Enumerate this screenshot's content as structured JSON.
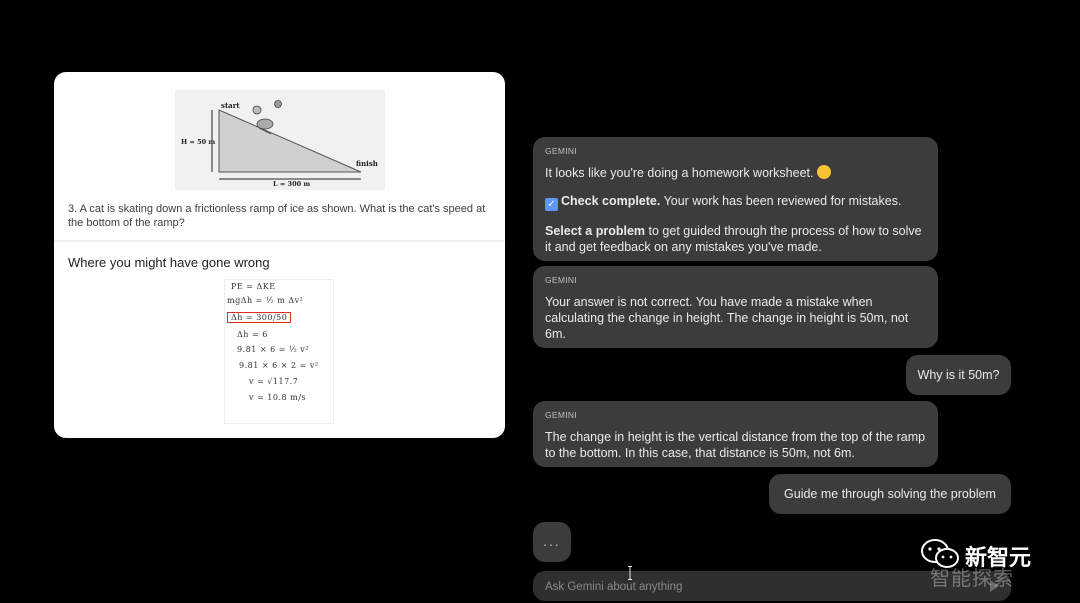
{
  "worksheet": {
    "diagram": {
      "start_label": "start",
      "finish_label": "finish",
      "height_label": "H = 50 m",
      "length_label": "L = 300 m"
    },
    "question": "3. A cat is skating down a frictionless ramp of ice as shown. What is the cat's speed at the bottom of the ramp?",
    "section_title": "Where you might have gone wrong",
    "handwriting": [
      "PE = ΔKE",
      "mgΔh = ½ m Δv²",
      "Δh = 300/50",
      "Δh = 6",
      "9.81 × 6 = ½ v²",
      "9.81 × 6 × 2 = v²",
      "v = √117.7",
      "v = 10.8 m/s"
    ]
  },
  "chat": {
    "sender_label": "GEMINI",
    "messages": [
      {
        "role": "gemini",
        "line1": "It looks like you're doing a homework worksheet.",
        "check_bold": "Check complete.",
        "check_rest": " Your work has been reviewed for mistakes.",
        "select_bold": "Select a problem",
        "select_rest": " to get guided through the process of how to solve it and get feedback on any mistakes you've made."
      },
      {
        "role": "gemini",
        "text": "Your answer is not correct. You have made a mistake when calculating the change in height. The change in height is 50m, not 6m."
      },
      {
        "role": "user",
        "text": "Why is it 50m?"
      },
      {
        "role": "gemini",
        "text": "The change in height is the vertical distance from the top of the ramp to the bottom. In this case, that distance is 50m, not 6m."
      },
      {
        "role": "user",
        "text": "Guide me through solving the problem"
      }
    ],
    "typing_indicator": "...",
    "composer_placeholder": "Ask Gemini about anything"
  },
  "watermark": {
    "text": "新智元",
    "subtext": "智能探索"
  },
  "icons": {
    "check": "check-box-icon",
    "emoji": "thinking-face-icon",
    "send": "send-icon",
    "watermark": "wechat-icon"
  }
}
